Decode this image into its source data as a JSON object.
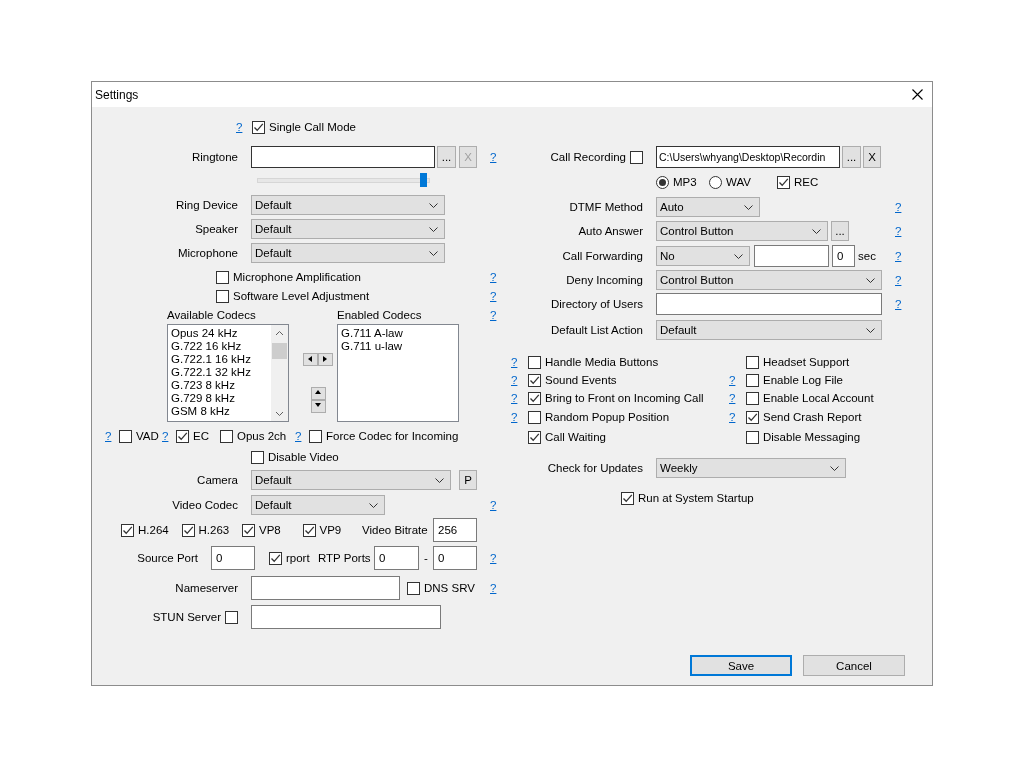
{
  "window": {
    "title": "Settings"
  },
  "single_call_mode": {
    "help": "?",
    "label": "Single Call Mode",
    "checked": true
  },
  "ringtone": {
    "label": "Ringtone",
    "browse": "...",
    "clear": "X",
    "clear_disabled": true,
    "help": "?",
    "volume": {
      "level": 0.98
    }
  },
  "devices": [
    {
      "label": "Ring Device",
      "value": "Default"
    },
    {
      "label": "Speaker",
      "value": "Default"
    },
    {
      "label": "Microphone",
      "value": "Default"
    }
  ],
  "mic_options": [
    {
      "label": "Microphone Amplification",
      "checked": false,
      "help": "?"
    },
    {
      "label": "Software Level Adjustment",
      "checked": false,
      "help": "?"
    }
  ],
  "codecs": {
    "available_label": "Available Codecs",
    "enabled_label": "Enabled Codecs",
    "help": "?",
    "available": [
      "Opus 24 kHz",
      "G.722 16 kHz",
      "G.722.1 16 kHz",
      "G.722.1 32 kHz",
      "G.723 8 kHz",
      "G.729 8 kHz",
      "GSM 8 kHz"
    ],
    "enabled": [
      "G.711 A-law",
      "G.711 u-law"
    ]
  },
  "codec_options": [
    {
      "help": "?",
      "label": "VAD",
      "checked": false
    },
    {
      "help": "?",
      "label": "EC",
      "checked": true
    },
    {
      "label": "Opus 2ch",
      "checked": false
    },
    {
      "help": "?",
      "label": "Force Codec for Incoming",
      "checked": false
    }
  ],
  "disable_video": {
    "label": "Disable Video",
    "checked": false
  },
  "camera": {
    "label": "Camera",
    "value": "Default",
    "button": "P"
  },
  "video_codec": {
    "label": "Video Codec",
    "value": "Default",
    "help": "?"
  },
  "video_codecs": [
    {
      "label": "H.264",
      "checked": true
    },
    {
      "label": "H.263",
      "checked": true
    },
    {
      "label": "VP8",
      "checked": true
    },
    {
      "label": "VP9",
      "checked": true
    }
  ],
  "video_bitrate": {
    "label": "Video Bitrate",
    "value": "256"
  },
  "source_port": {
    "label": "Source Port",
    "value": "0"
  },
  "rport": {
    "label": "rport",
    "checked": true
  },
  "rtp_ports": {
    "label": "RTP Ports",
    "from": "0",
    "separator": "-",
    "to": "0",
    "help": "?"
  },
  "nameserver": {
    "label": "Nameserver",
    "dns_srv": {
      "label": "DNS SRV",
      "checked": false
    },
    "help": "?"
  },
  "stun_server": {
    "label": "STUN Server",
    "checked": false
  },
  "call_recording": {
    "label": "Call Recording",
    "checked": false,
    "path": "C:\\Users\\whyang\\Desktop\\Recordin",
    "browse": "...",
    "clear": "X",
    "formats": [
      {
        "label": "MP3",
        "selected": true
      },
      {
        "label": "WAV",
        "selected": false
      }
    ],
    "rec": {
      "label": "REC",
      "checked": true
    }
  },
  "dtmf_method": {
    "label": "DTMF Method",
    "value": "Auto",
    "help": "?"
  },
  "auto_answer": {
    "label": "Auto Answer",
    "value": "Control Button",
    "button": "...",
    "help": "?"
  },
  "call_forwarding": {
    "label": "Call Forwarding",
    "value": "No",
    "timeout": "0",
    "unit": "sec",
    "help": "?"
  },
  "deny_incoming": {
    "label": "Deny Incoming",
    "value": "Control Button",
    "help": "?"
  },
  "directory_of_users": {
    "label": "Directory of Users",
    "help": "?"
  },
  "default_list_action": {
    "label": "Default List Action",
    "value": "Default"
  },
  "options": [
    {
      "left": {
        "help": "?",
        "label": "Handle Media Buttons",
        "checked": false
      },
      "right": {
        "label": "Headset Support",
        "checked": false
      }
    },
    {
      "left": {
        "help": "?",
        "label": "Sound Events",
        "checked": true
      },
      "right": {
        "help": "?",
        "label": "Enable Log File",
        "checked": false
      }
    },
    {
      "left": {
        "help": "?",
        "label": "Bring to Front on Incoming Call",
        "checked": true
      },
      "right": {
        "help": "?",
        "label": "Enable Local Account",
        "checked": false
      }
    },
    {
      "left": {
        "help": "?",
        "label": "Random Popup Position",
        "checked": false
      },
      "right": {
        "help": "?",
        "label": "Send Crash Report",
        "checked": true
      }
    },
    {
      "left": {
        "label": "Call Waiting",
        "checked": true
      },
      "right": {
        "label": "Disable Messaging",
        "checked": false
      }
    }
  ],
  "check_for_updates": {
    "label": "Check for Updates",
    "value": "Weekly"
  },
  "run_at_startup": {
    "label": "Run at System Startup",
    "checked": true
  },
  "buttons": [
    {
      "label": "Save",
      "focused": true
    },
    {
      "label": "Cancel",
      "focused": false
    }
  ]
}
